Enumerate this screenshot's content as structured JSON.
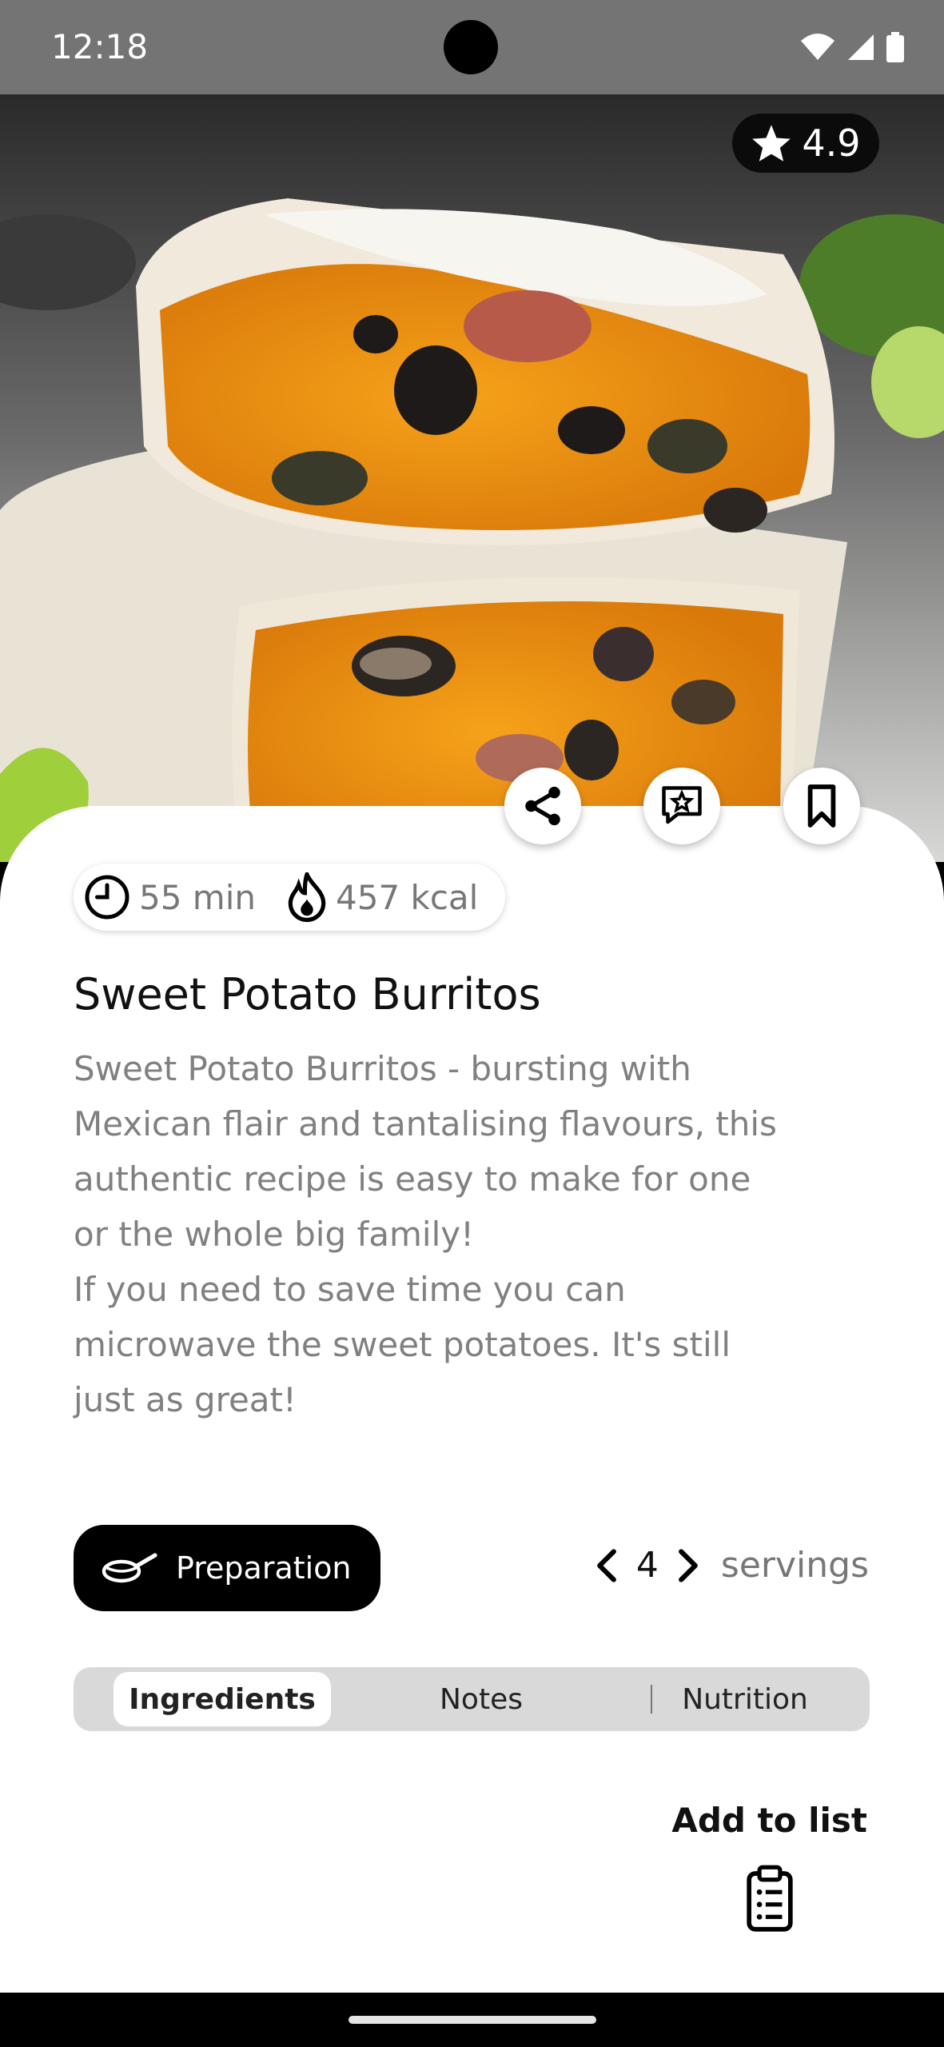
{
  "status_bar": {
    "time": "12:18",
    "icons": [
      "wifi-icon",
      "signal-icon",
      "battery-icon"
    ]
  },
  "recipe": {
    "rating": "4.9",
    "time": "55 min",
    "calories": "457 kcal",
    "title": "Sweet Potato Burritos",
    "description": "Sweet Potato Burritos - bursting with\nMexican flair and tantalising flavours, this\nauthentic recipe is easy to make for one\nor the whole big family!\nIf you need to save time you can\nmicrowave the sweet potatoes. It's still\njust as great!"
  },
  "actions": {
    "icons": [
      "share-icon",
      "review-icon",
      "bookmark-icon"
    ]
  },
  "preparation": {
    "label": "Preparation"
  },
  "servings": {
    "count": "4",
    "label": "servings"
  },
  "tabs": [
    {
      "label": "Ingredients",
      "active": true
    },
    {
      "label": "Notes",
      "active": false
    },
    {
      "label": "Nutrition",
      "active": false
    }
  ],
  "add_to_list": {
    "label": "Add to list"
  },
  "colors": {
    "accent": "#000000",
    "muted_text": "#808080",
    "tab_bg": "#d9d9d9"
  }
}
